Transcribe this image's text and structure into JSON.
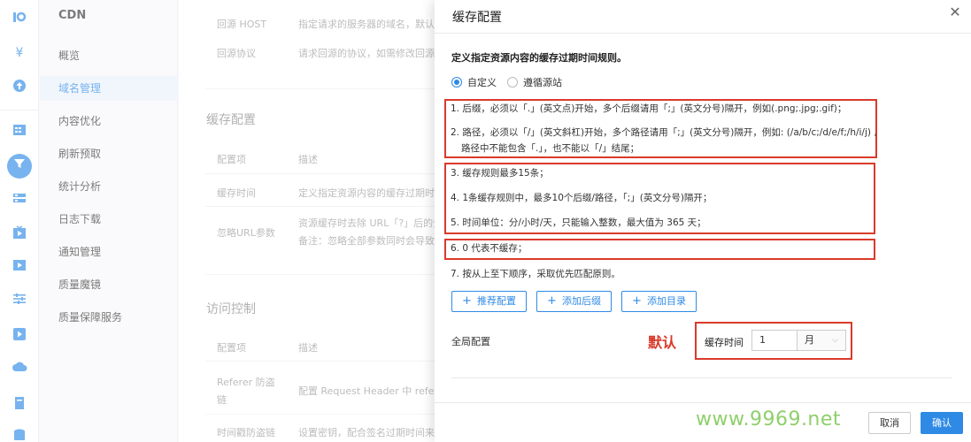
{
  "rail": {
    "icons": [
      "logo-icon",
      "yen-icon",
      "upload-icon",
      "server-icon",
      "cdn-icon",
      "storage-icon",
      "video-icon",
      "media-icon",
      "settings-icon",
      "play-icon",
      "cloud-icon",
      "document-icon",
      "database-icon"
    ]
  },
  "sidebar": {
    "title": "CDN",
    "items": [
      {
        "label": "概览"
      },
      {
        "label": "域名管理",
        "active": true
      },
      {
        "label": "内容优化"
      },
      {
        "label": "刷新预取"
      },
      {
        "label": "统计分析"
      },
      {
        "label": "日志下载"
      },
      {
        "label": "通知管理"
      },
      {
        "label": "质量魔镜"
      },
      {
        "label": "质量保障服务"
      }
    ]
  },
  "background": {
    "rows_top": [
      {
        "key": "回源 HOST",
        "value": "指定请求的服务器的域名，默认为"
      },
      {
        "key": "回源协议",
        "value": "请求回源的协议，如需修改回源协"
      }
    ],
    "cache_section": {
      "title": "缓存配置",
      "headers": [
        "配置项",
        "描述"
      ],
      "rows": [
        {
          "key": "缓存时间",
          "value": "定义指定资源内容的缓存过期时间"
        },
        {
          "key": "忽略URL参数",
          "value": "资源缓存时去除 URL「?」后的全",
          "value2": "备注：忽略全部参数同时会导致"
        }
      ]
    },
    "access_section": {
      "title": "访问控制",
      "headers": [
        "配置项",
        "描述"
      ],
      "rows": [
        {
          "key": "Referer 防盗",
          "key2": "链",
          "value": "配置 Request Header 中 referer"
        },
        {
          "key": "时间戳防盗链",
          "value": "设置密钥，配合签名过期时间来"
        }
      ]
    }
  },
  "drawer": {
    "title": "缓存配置",
    "description": "定义指定资源内容的缓存过期时间规则。",
    "radios": [
      {
        "label": "自定义",
        "checked": true
      },
      {
        "label": "遵循源站",
        "checked": false
      }
    ],
    "rules": [
      "1. 后缀，必须以「.」(英文点)开始，多个后缀请用「;」(英文分号)隔开，例如(.png;.jpg;.gif)；",
      "2. 路径，必须以「/」(英文斜杠)开始，多个路径请用「;」(英文分号)隔开，例如: (/a/b/c;/d/e/f;/h/i/j) ,",
      "路径中不能包含「.」，也不能以「/」结尾；",
      "3. 缓存规则最多15条；",
      "4. 1条缓存规则中，最多10个后缀/路径，「;」(英文分号)隔开；",
      "5. 时间单位：分/小时/天，只能输入整数，最大值为 365 天；",
      "6. 0 代表不缓存；",
      "7. 按从上至下顺序，采取优先匹配原则。"
    ],
    "buttons": {
      "recommend": "推荐配置",
      "add_suffix": "添加后缀",
      "add_dir": "添加目录"
    },
    "global": {
      "label": "全局配置",
      "annotation": "默认",
      "cache_time_label": "缓存时间",
      "cache_time_value": "1",
      "cache_time_unit": "月"
    },
    "footer": {
      "cancel": "取消",
      "confirm": "确认"
    }
  },
  "watermark": "www.9969.net",
  "colors": {
    "accent": "#2f8ae5",
    "annotation_red": "#d93a2b",
    "watermark_green": "#8fcf6b"
  }
}
